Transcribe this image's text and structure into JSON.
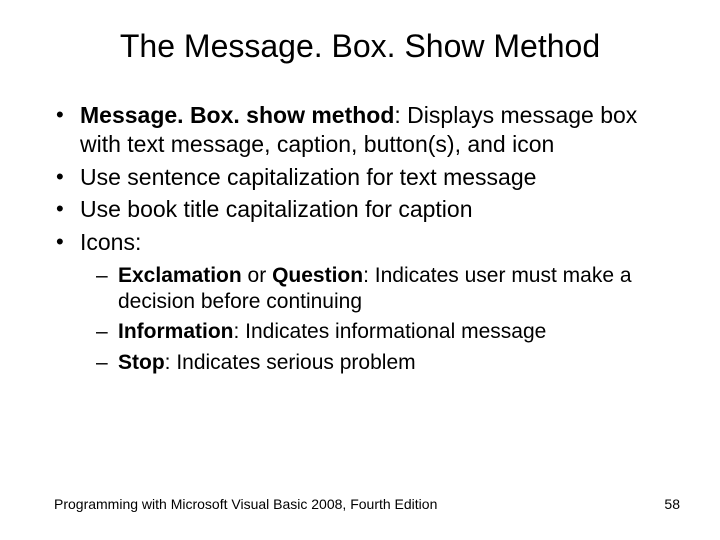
{
  "title": "The Message. Box. Show Method",
  "bullets": [
    {
      "bold": "Message. Box. show method",
      "rest": ": Displays message box with text message, caption, button(s), and icon"
    },
    {
      "rest": "Use sentence capitalization for text message"
    },
    {
      "rest": "Use book title capitalization for caption"
    },
    {
      "rest": "Icons:"
    }
  ],
  "subbullets": [
    {
      "bold": "Exclamation",
      "mid": " or ",
      "bold2": "Question",
      "rest": ": Indicates user must make a decision before continuing"
    },
    {
      "bold": "Information",
      "rest": ": Indicates informational message"
    },
    {
      "bold": "Stop",
      "rest": ": Indicates serious problem"
    }
  ],
  "footer": "Programming with Microsoft Visual Basic 2008, Fourth Edition",
  "page": "58"
}
